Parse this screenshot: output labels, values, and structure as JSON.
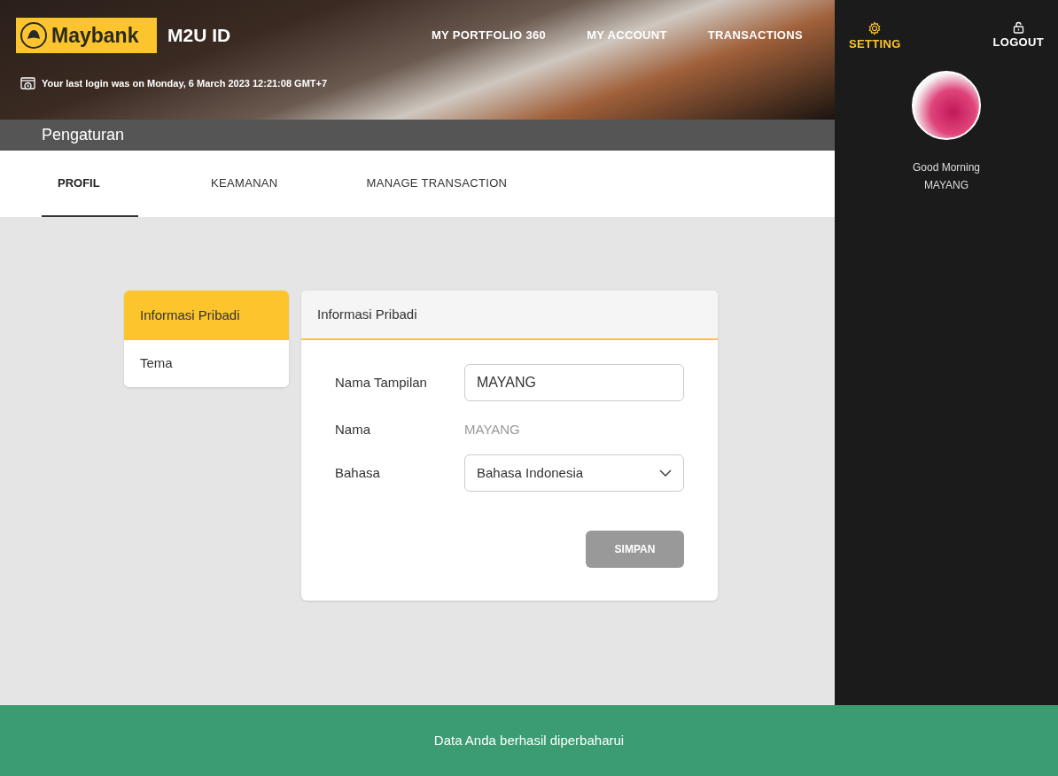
{
  "header": {
    "logo": "Maybank",
    "app_name": "M2U ID",
    "nav": [
      "MY PORTFOLIO 360",
      "MY ACCOUNT",
      "TRANSACTIONS"
    ],
    "last_login": "Your last login was on Monday, 6 March 2023 12:21:08 GMT+7"
  },
  "side_panel": {
    "actions": [
      {
        "kind": "setting",
        "label": "SETTING",
        "selected": true
      },
      {
        "kind": "logout",
        "label": "LOGOUT",
        "selected": false
      }
    ],
    "greeting": "Good Morning",
    "user": "MAYANG"
  },
  "page_title": "Pengaturan",
  "tabs": [
    {
      "label": "PROFIL",
      "selected": true
    },
    {
      "label": "KEAMANAN",
      "selected": false
    },
    {
      "label": "MANAGE TRANSACTION",
      "selected": false
    }
  ],
  "side_menu": [
    {
      "label": "Informasi Pribadi",
      "selected": true
    },
    {
      "label": "Tema",
      "selected": false
    }
  ],
  "card": {
    "title": "Informasi Pribadi",
    "fields": [
      {
        "kind": "input",
        "label": "Nama Tampilan",
        "value": "MAYANG"
      },
      {
        "kind": "text",
        "label": "Nama",
        "value": "MAYANG"
      },
      {
        "kind": "select",
        "label": "Bahasa",
        "value": "Bahasa Indonesia"
      }
    ],
    "save_button": {
      "label": "SIMPAN",
      "disabled": true
    }
  },
  "toast": "Data Anda berhasil diperbaharui"
}
